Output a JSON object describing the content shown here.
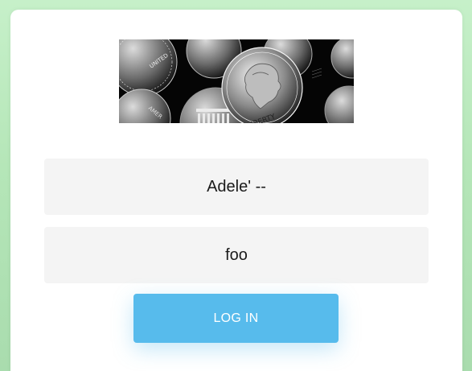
{
  "banner": {
    "image_description": "black and white coins",
    "coin_text": [
      "LIBERTY",
      "UNITED",
      "AMER"
    ]
  },
  "form": {
    "username_value": "Adele' --",
    "password_value": "foo",
    "login_label": "LOG IN"
  },
  "colors": {
    "background": "#b5e6b8",
    "card": "#ffffff",
    "field": "#f4f4f4",
    "button": "#57bbec"
  }
}
